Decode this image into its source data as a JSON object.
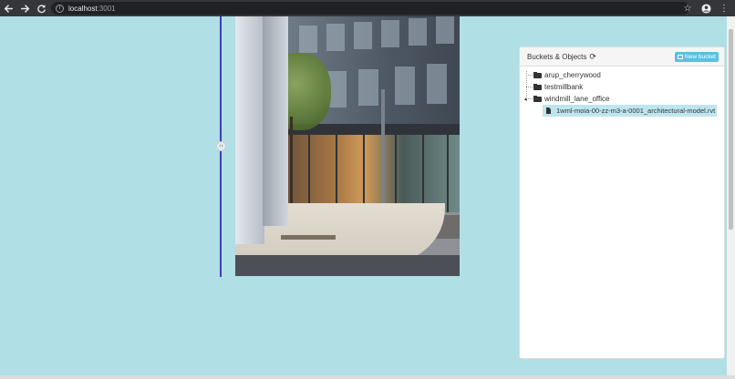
{
  "browser": {
    "url_host": "localhost",
    "url_port": ":3001",
    "icons": [
      "back-arrow-icon",
      "forward-arrow-icon",
      "reload-icon",
      "info-icon",
      "star-icon",
      "profile-icon",
      "menu-dots-icon"
    ]
  },
  "panel": {
    "title": "Buckets & Objects",
    "new_bucket_label": "New bucket",
    "buckets": [
      {
        "name": "arup_cherrywood"
      },
      {
        "name": "testmillbank"
      },
      {
        "name": "windmill_lane_office",
        "expanded": true,
        "objects": [
          {
            "name": "1wml-moia-00-zz-m3-a-0001_architectural-model.rvt",
            "selected": true
          }
        ]
      }
    ]
  },
  "colors": {
    "page_background": "#b0dfe5",
    "button_info": "#5bc0de",
    "selection": "#bee6f0",
    "divider": "#3f3fb8"
  }
}
